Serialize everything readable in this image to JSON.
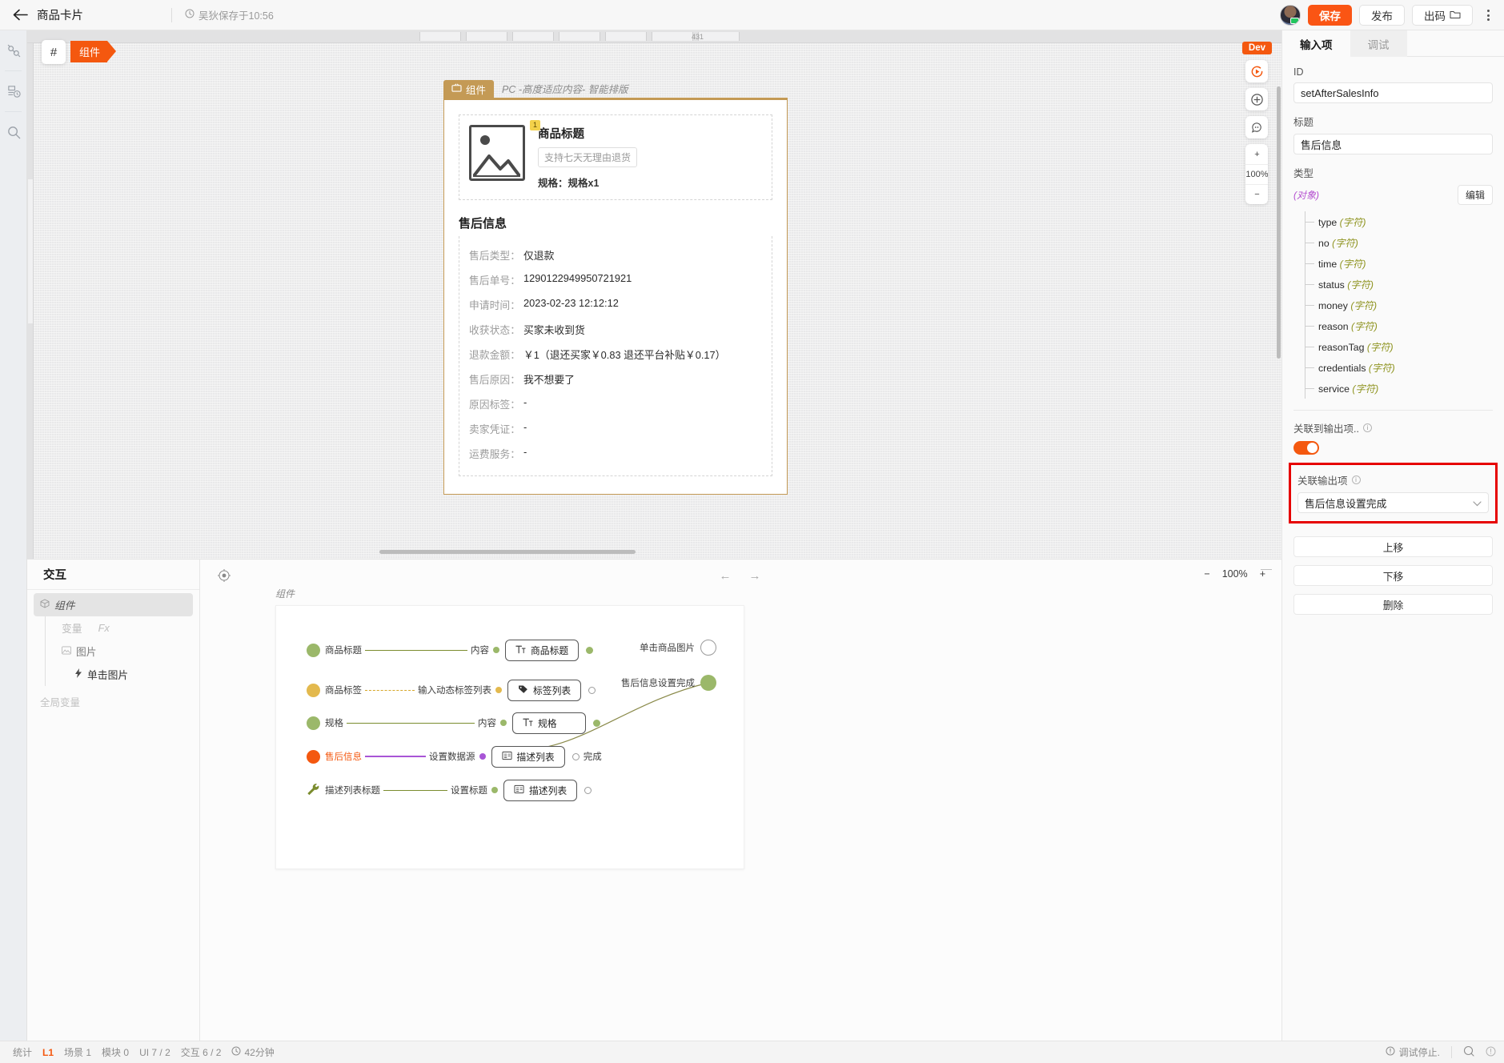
{
  "topbar": {
    "back_icon": "back-arrow-icon",
    "title": "商品卡片",
    "clock_icon": "clock-icon",
    "saved_text": "吴狄保存于10:56",
    "save_label": "保存",
    "publish_label": "发布",
    "export_label": "出码",
    "export_icon": "folder-icon",
    "more_icon": "kebab-menu-icon",
    "accent": "#fa5514"
  },
  "rail": {
    "items": [
      {
        "icon": "plugin-icon",
        "name": "plugin"
      },
      {
        "icon": "history-doc-icon",
        "name": "history"
      },
      {
        "icon": "search-icon",
        "name": "search"
      }
    ]
  },
  "canvas": {
    "hash_label": "#",
    "component_tag": "组件",
    "ruler_value": "431",
    "dev_badge": "Dev",
    "zoom_in": "+",
    "zoom_level": "100%",
    "zoom_out": "−",
    "tool_play": "play-icon",
    "tool_add": "add-circle-icon",
    "tool_comment": "comment-icon"
  },
  "preview": {
    "tab_label": "组件",
    "tab_icon": "component-icon",
    "mode_label": "PC -高度适应内容- 智能排版",
    "goods": {
      "badge": "1",
      "title": "商品标题",
      "tag": "支持七天无理由退货",
      "spec": "规格：规格x1"
    },
    "section_title": "售后信息",
    "rows": [
      {
        "label": "售后类型：",
        "value": "仅退款"
      },
      {
        "label": "售后单号：",
        "value": "1290122949950721921"
      },
      {
        "label": "申请时间：",
        "value": "2023-02-23 12:12:12"
      },
      {
        "label": "收获状态：",
        "value": "买家未收到货"
      },
      {
        "label": "退款金额：",
        "value": "￥1（退还买家￥0.83 退还平台补贴￥0.17）"
      },
      {
        "label": "售后原因：",
        "value": "我不想要了"
      },
      {
        "label": "原因标签：",
        "value": "-"
      },
      {
        "label": "卖家凭证：",
        "value": "-"
      },
      {
        "label": "运费服务：",
        "value": "-"
      }
    ]
  },
  "interaction": {
    "title": "交互",
    "root": {
      "label": "组件",
      "icon": "cube-icon"
    },
    "variable_label": "变量",
    "fx_label": "Fx",
    "image_label": "图片",
    "image_icon": "image-icon",
    "click_label": "单击图片",
    "click_icon": "lightning-icon",
    "global_label": "全局变量",
    "collapse_icon": "minimize-icon"
  },
  "graph": {
    "board_label": "组件",
    "target_icon": "target-icon",
    "nav_back": "←",
    "nav_forward": "→",
    "zoom_out": "−",
    "zoom_level": "100%",
    "zoom_in": "+",
    "rows": [
      {
        "name": "商品标题",
        "dot_color": "#9bb86a",
        "line": "solid-green",
        "port": "内容",
        "port_color": "#9bb86a",
        "node": "商品标题",
        "node_icon": "text-icon",
        "out": "dot",
        "out_color": "#9bb86a"
      },
      {
        "name": "商品标签",
        "dot_color": "#e3b94e",
        "line": "dashed-amber",
        "port": "输入动态标签列表",
        "port_color": "#e3b94e",
        "node": "标签列表",
        "node_icon": "tag-icon",
        "out": "ring",
        "out_color": "#9b9b9b"
      },
      {
        "name": "规格",
        "dot_color": "#9bb86a",
        "line": "solid-green",
        "port": "内容",
        "port_color": "#9bb86a",
        "node": "规格",
        "node_icon": "text-icon",
        "out": "dot",
        "out_color": "#9bb86a"
      },
      {
        "name": "售后信息",
        "dot_color": "#f4580f",
        "line": "solid-purple",
        "port": "设置数据源",
        "port_color": "#a855d6",
        "node": "描述列表",
        "node_icon": "desc-list-icon",
        "out": "ring",
        "out_color": "#9b9b9b",
        "out_label": "完成",
        "name_color": "#f4580f"
      },
      {
        "name": "描述列表标题",
        "dot_color": "#7b8c2e",
        "dot_icon": "wrench-icon",
        "line": "solid-green",
        "port": "设置标题",
        "port_color": "#9bb86a",
        "node": "描述列表",
        "node_icon": "desc-list-icon",
        "out": "ring",
        "out_color": "#9b9b9b"
      }
    ],
    "outputs": [
      {
        "label": "单击商品图片",
        "type": "ring",
        "color": "#9b9b9b"
      },
      {
        "label": "售后信息设置完成",
        "type": "dot",
        "color": "#9bb86a"
      }
    ]
  },
  "right_panel": {
    "tabs": [
      {
        "label": "输入项",
        "active": true
      },
      {
        "label": "调试",
        "active": false
      }
    ],
    "id_label": "ID",
    "id_value": "setAfterSalesInfo",
    "title_label": "标题",
    "title_value": "售后信息",
    "type_label": "类型",
    "type_value": "(对象)",
    "edit_label": "编辑",
    "fields": [
      {
        "name": "type",
        "type": "(字符)"
      },
      {
        "name": "no",
        "type": "(字符)"
      },
      {
        "name": "time",
        "type": "(字符)"
      },
      {
        "name": "status",
        "type": "(字符)"
      },
      {
        "name": "money",
        "type": "(字符)"
      },
      {
        "name": "reason",
        "type": "(字符)"
      },
      {
        "name": "reasonTag",
        "type": "(字符)"
      },
      {
        "name": "credentials",
        "type": "(字符)"
      },
      {
        "name": "service",
        "type": "(字符)"
      }
    ],
    "link_toggle_label": "关联到输出项..",
    "link_toggle_on": true,
    "link_output_label": "关联输出项",
    "link_output_value": "售后信息设置完成",
    "highlight_color": "#e60000",
    "buttons": [
      {
        "label": "上移",
        "name": "move-up-button"
      },
      {
        "label": "下移",
        "name": "move-down-button"
      },
      {
        "label": "删除",
        "name": "delete-button"
      }
    ]
  },
  "statusbar": {
    "stats_label": "统计",
    "level": "L1",
    "scene_label": "场景 1",
    "module_label": "模块 0",
    "ui_label": "UI 7 / 2",
    "interaction_label": "交互 6 / 2",
    "time_label": "42分钟",
    "clock_icon": "clock-icon",
    "debug_label": "调试停止.",
    "debug_icon": "warning-circle-icon",
    "search_icon": "search-circle-icon",
    "help_icon": "help-circle-icon"
  }
}
